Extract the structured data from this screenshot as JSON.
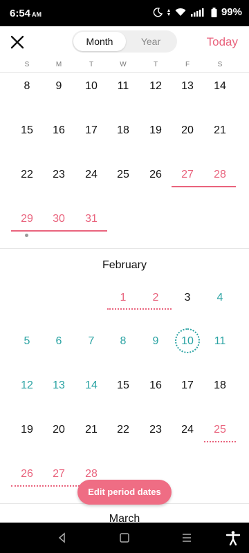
{
  "status": {
    "time": "6:54",
    "ampm": "AM",
    "battery": "99%"
  },
  "header": {
    "segment_month": "Month",
    "segment_year": "Year",
    "today_label": "Today"
  },
  "weekdays": [
    "S",
    "M",
    "T",
    "W",
    "T",
    "F",
    "S"
  ],
  "january_rows": [
    [
      "8",
      "9",
      "10",
      "11",
      "12",
      "13",
      "14"
    ],
    [
      "15",
      "16",
      "17",
      "18",
      "19",
      "20",
      "21"
    ],
    [
      "22",
      "23",
      "24",
      "25",
      "26",
      "27",
      "28"
    ],
    [
      "29",
      "30",
      "31"
    ]
  ],
  "february": {
    "label": "February",
    "rows": [
      [
        "",
        "",
        "",
        "1",
        "2",
        "3",
        "4"
      ],
      [
        "5",
        "6",
        "7",
        "8",
        "9",
        "10",
        "11"
      ],
      [
        "12",
        "13",
        "14",
        "15",
        "16",
        "17",
        "18"
      ],
      [
        "19",
        "20",
        "21",
        "22",
        "23",
        "24",
        "25"
      ],
      [
        "26",
        "27",
        "28"
      ]
    ]
  },
  "next_month_label": "March",
  "edit_button": "Edit period dates",
  "colors": {
    "period_pink": "#e9637d",
    "fertile_teal": "#2aa3a3",
    "button_pink": "#ef6d84"
  }
}
